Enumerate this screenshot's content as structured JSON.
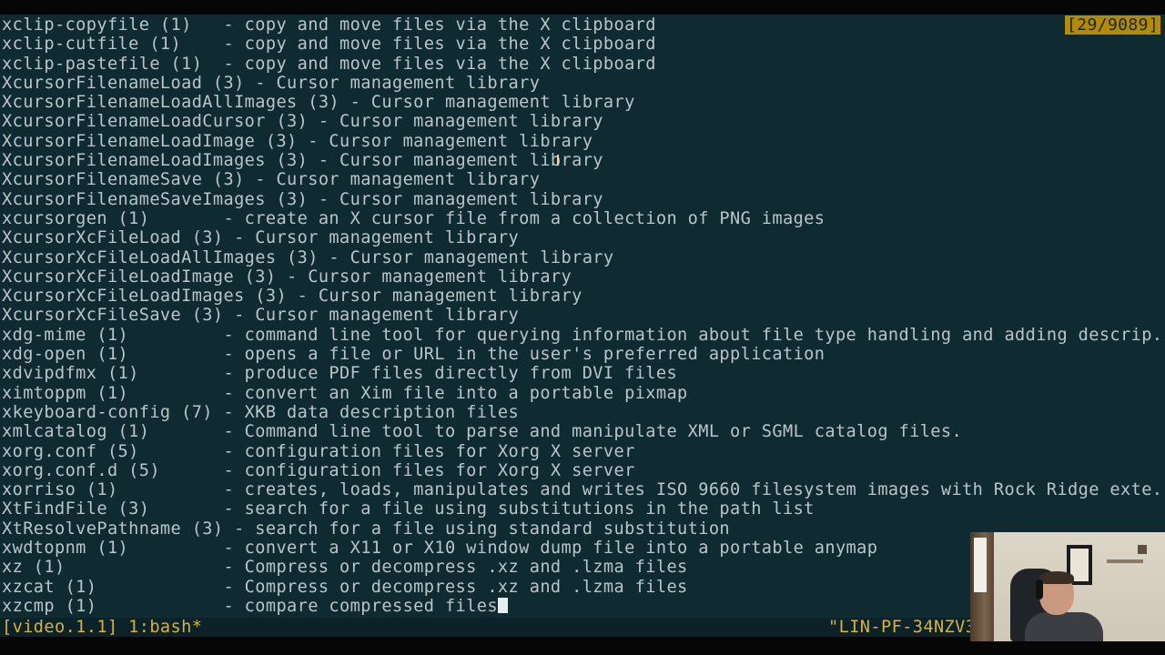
{
  "counter": "[29/9089]",
  "lines": [
    "xclip-copyfile (1)   - copy and move files via the X clipboard",
    "xclip-cutfile (1)    - copy and move files via the X clipboard",
    "xclip-pastefile (1)  - copy and move files via the X clipboard",
    "XcursorFilenameLoad (3) - Cursor management library",
    "XcursorFilenameLoadAllImages (3) - Cursor management library",
    "XcursorFilenameLoadCursor (3) - Cursor management library",
    "XcursorFilenameLoadImage (3) - Cursor management library",
    "XcursorFilenameLoadImages (3) - Cursor management library",
    "XcursorFilenameSave (3) - Cursor management library",
    "XcursorFilenameSaveImages (3) - Cursor management library",
    "xcursorgen (1)       - create an X cursor file from a collection of PNG images",
    "XcursorXcFileLoad (3) - Cursor management library",
    "XcursorXcFileLoadAllImages (3) - Cursor management library",
    "XcursorXcFileLoadImage (3) - Cursor management library",
    "XcursorXcFileLoadImages (3) - Cursor management library",
    "XcursorXcFileSave (3) - Cursor management library",
    "xdg-mime (1)         - command line tool for querying information about file type handling and adding descrip...",
    "xdg-open (1)         - opens a file or URL in the user's preferred application",
    "xdvipdfmx (1)        - produce PDF files directly from DVI files",
    "ximtoppm (1)         - convert an Xim file into a portable pixmap",
    "xkeyboard-config (7) - XKB data description files",
    "xmlcatalog (1)       - Command line tool to parse and manipulate XML or SGML catalog files.",
    "xorg.conf (5)        - configuration files for Xorg X server",
    "xorg.conf.d (5)      - configuration files for Xorg X server",
    "xorriso (1)          - creates, loads, manipulates and writes ISO 9660 filesystem images with Rock Ridge exte...",
    "XtFindFile (3)       - search for a file using substitutions in the path list",
    "XtResolvePathname (3) - search for a file using standard substitution",
    "xwdtopnm (1)         - convert a X11 or X10 window dump file into a portable anymap",
    "xz (1)               - Compress or decompress .xz and .lzma files",
    "xzcat (1)            - Compress or decompress .xz and .lzma files"
  ],
  "prompt_line": "xzcmp (1)            - compare compressed files",
  "status": {
    "left": "[video.1.1] 1:bash*",
    "right": "\"LIN-PF-34NZV3"
  },
  "colors": {
    "background": "#0f2a30",
    "text": "#b8c6ca",
    "status_text": "#d9b23a",
    "counter_bg": "#b58a00"
  }
}
